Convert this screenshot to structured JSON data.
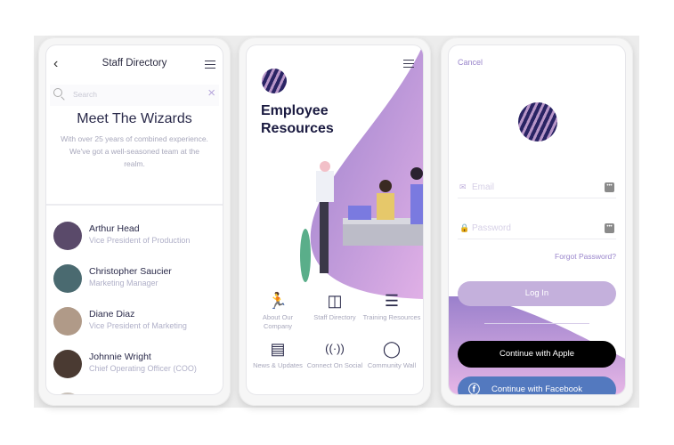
{
  "staff_directory": {
    "title": "Staff Directory",
    "search_placeholder": "Search",
    "heading": "Meet The Wizards",
    "description": "With over 25 years of combined experience. We've got a well-seasoned team at the realm.",
    "people": [
      {
        "name": "Arthur Head",
        "role": "Vice President of Production",
        "color": "#5a4a6a"
      },
      {
        "name": "Christopher Saucier",
        "role": "Marketing Manager",
        "color": "#4a6a70"
      },
      {
        "name": "Diane Diaz",
        "role": "Vice President of Marketing",
        "color": "#8a7060"
      },
      {
        "name": "Johnnie Wright",
        "role": "Chief Operating Officer (COO)",
        "color": "#4a3a32"
      }
    ]
  },
  "employee_resources": {
    "title_line1": "Employee",
    "title_line2": "Resources",
    "items": [
      {
        "label": "About Our Company",
        "icon": "running-person-icon",
        "glyph": "🏃"
      },
      {
        "label": "Staff Directory",
        "icon": "board-icon",
        "glyph": "◫"
      },
      {
        "label": "Training Resources",
        "icon": "layers-icon",
        "glyph": "☰"
      },
      {
        "label": "News & Updates",
        "icon": "newspaper-icon",
        "glyph": "▤"
      },
      {
        "label": "Connect On Social",
        "icon": "broadcast-icon",
        "glyph": "((·))"
      },
      {
        "label": "Community Wall",
        "icon": "speech-bubble-icon",
        "glyph": "💬"
      }
    ]
  },
  "login": {
    "cancel_label": "Cancel",
    "email_placeholder": "Email",
    "password_placeholder": "Password",
    "forgot_label": "Forgot Password?",
    "login_label": "Log In",
    "apple_label": "Continue with Apple",
    "facebook_label": "Continue with Facebook"
  },
  "colors": {
    "accent": "#9a86cc",
    "facebook": "#5379bf",
    "apple": "#000000"
  }
}
